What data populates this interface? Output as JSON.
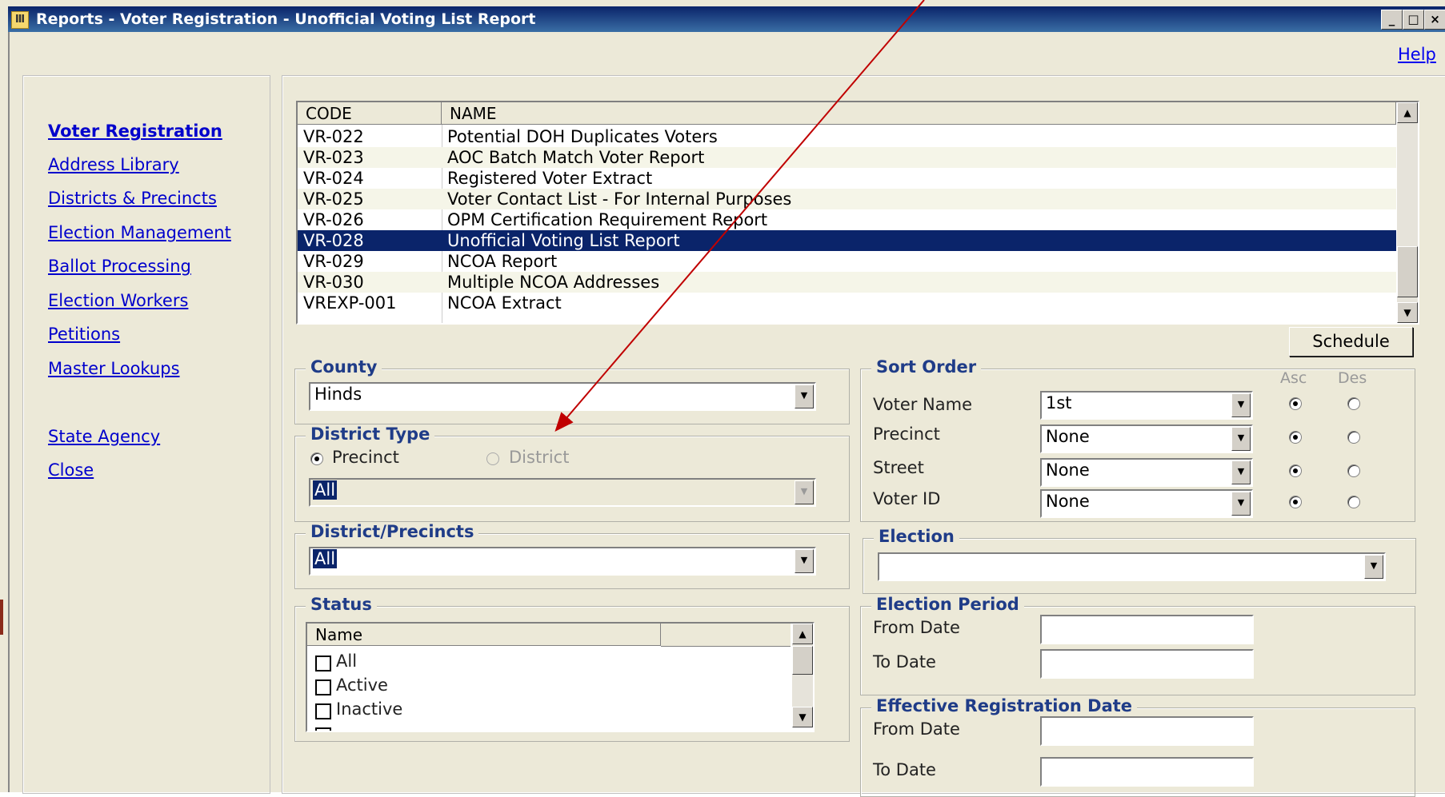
{
  "window": {
    "title": "Reports - Voter Registration - Unofficial Voting List Report",
    "min_label": "_",
    "max_label": "□",
    "close_label": "×"
  },
  "help_link": "Help",
  "nav": {
    "items": [
      {
        "label": "Voter Registration",
        "bold": true
      },
      {
        "label": "Address Library"
      },
      {
        "label": "Districts & Precincts"
      },
      {
        "label": "Election Management"
      },
      {
        "label": "Ballot Processing"
      },
      {
        "label": "Election Workers"
      },
      {
        "label": "Petitions"
      },
      {
        "label": "Master Lookups"
      },
      {
        "label": "State Agency"
      },
      {
        "label": "Close"
      }
    ]
  },
  "report_grid": {
    "columns": [
      "CODE",
      "NAME"
    ],
    "rows": [
      {
        "code": "VR-022",
        "name": "Potential DOH Duplicates Voters"
      },
      {
        "code": "VR-023",
        "name": "AOC Batch Match Voter Report"
      },
      {
        "code": "VR-024",
        "name": "Registered Voter Extract"
      },
      {
        "code": "VR-025",
        "name": "Voter Contact List - For Internal Purposes"
      },
      {
        "code": "VR-026",
        "name": "OPM Certification Requirement Report"
      },
      {
        "code": "VR-028",
        "name": "Unofficial Voting List Report",
        "selected": true
      },
      {
        "code": "VR-029",
        "name": "NCOA Report"
      },
      {
        "code": "VR-030",
        "name": "Multiple NCOA Addresses"
      },
      {
        "code": "VREXP-001",
        "name": "NCOA Extract"
      }
    ]
  },
  "schedule_button": "Schedule",
  "county": {
    "legend": "County",
    "value": "Hinds"
  },
  "district_type": {
    "legend": "District Type",
    "precinct_label": "Precinct",
    "district_label": "District",
    "selected": "Precinct",
    "value": "All"
  },
  "district_precincts": {
    "legend": "District/Precincts",
    "value": "All"
  },
  "status": {
    "legend": "Status",
    "column": "Name",
    "items": [
      "All",
      "Active",
      "Inactive"
    ]
  },
  "sort_order": {
    "legend": "Sort Order",
    "asc_label": "Asc",
    "des_label": "Des",
    "rows": [
      {
        "label": "Voter Name",
        "value": "1st",
        "dir": "asc"
      },
      {
        "label": "Precinct",
        "value": "None",
        "dir": "asc"
      },
      {
        "label": "Street",
        "value": "None",
        "dir": "asc"
      },
      {
        "label": "Voter ID",
        "value": "None",
        "dir": "asc"
      }
    ]
  },
  "election": {
    "legend": "Election",
    "value": ""
  },
  "election_period": {
    "legend": "Election Period",
    "from_label": "From Date",
    "to_label": "To Date"
  },
  "effective_registration": {
    "legend": "Effective Registration Date",
    "from_label": "From Date",
    "to_label": "To Date"
  },
  "colors": {
    "selection": "#0a246a",
    "legend_text": "#1f3c88",
    "link": "#0000cc",
    "annotation_arrow": "#c00000"
  }
}
